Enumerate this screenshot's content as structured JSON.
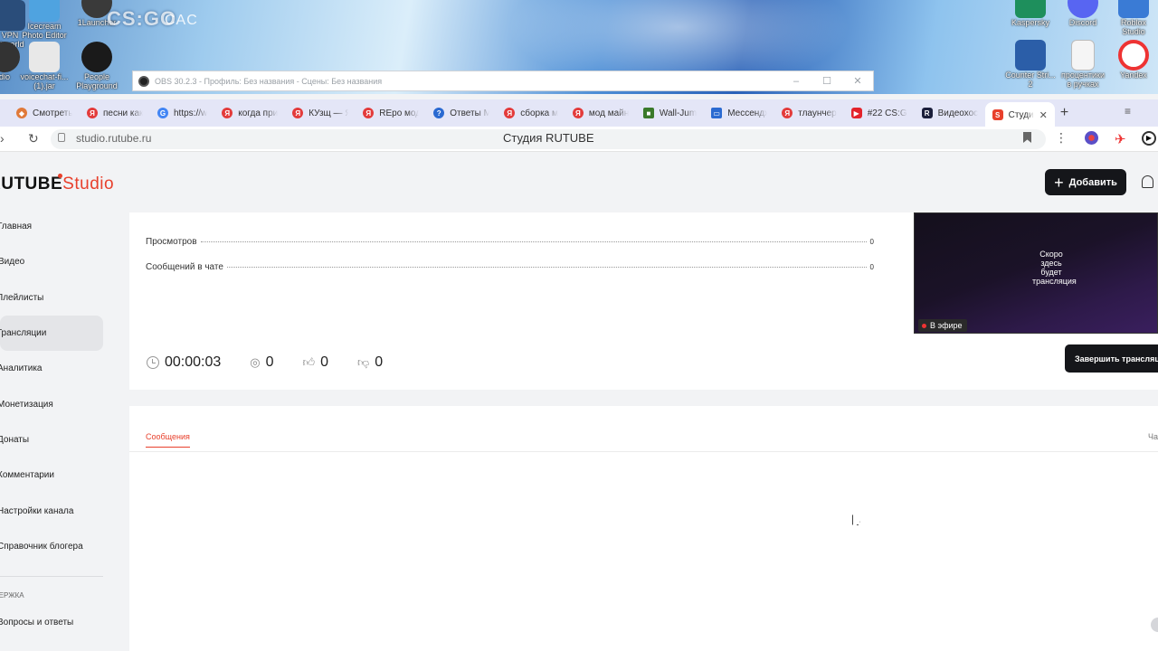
{
  "desktop": {
    "icons": [
      {
        "label": "VPN\nct world",
        "color": "#2a4d7a"
      },
      {
        "label": "Icecream\nPhoto Editor",
        "color": "#4fa3e0"
      },
      {
        "label": "1Launcher",
        "color": "#3a3a3a"
      },
      {
        "label": "dio",
        "color": "#333333"
      },
      {
        "label": "voicechat-fi...\n(1).jar",
        "color": "#e8e8e8"
      },
      {
        "label": "People\nPlayground",
        "color": "#1a1a1a"
      },
      {
        "label": "Kaspersky",
        "color": "#1e8f5c"
      },
      {
        "label": "Discord",
        "color": "#5865f2"
      },
      {
        "label": "Roblox\nStudio",
        "color": "#3a7bd5"
      },
      {
        "label": "Counter Stri...\n2",
        "color": "#2b5ea8"
      },
      {
        "label": "процентики\nв ручках",
        "color": "#f5f5f5"
      },
      {
        "label": "Yandex",
        "color": "#ffffff"
      }
    ],
    "csgo_logo": "CS:GO",
    "cac_logo": "CAC"
  },
  "obs": {
    "title": "OBS 30.2.3 - Профиль: Без названия - Сцены: Без названия",
    "minimize": "–",
    "maximize": "☐",
    "close": "✕"
  },
  "browser": {
    "tabs": [
      {
        "label": "Смотреть",
        "fav_color": "#e07a3a",
        "fav_glyph": "◆"
      },
      {
        "label": "песни как",
        "fav_color": "#e33b3b",
        "fav_glyph": "Я"
      },
      {
        "label": "https://w",
        "fav_color": "#4285f4",
        "fav_glyph": "G"
      },
      {
        "label": "когда при",
        "fav_color": "#e33b3b",
        "fav_glyph": "Я"
      },
      {
        "label": "КУзщ — Я",
        "fav_color": "#e33b3b",
        "fav_glyph": "Я"
      },
      {
        "label": "REpo мод",
        "fav_color": "#e33b3b",
        "fav_glyph": "Я"
      },
      {
        "label": "Ответы М",
        "fav_color": "#2a6ad1",
        "fav_glyph": "?"
      },
      {
        "label": "сборка м",
        "fav_color": "#e33b3b",
        "fav_glyph": "Я"
      },
      {
        "label": "мод майн",
        "fav_color": "#e33b3b",
        "fav_glyph": "Я"
      },
      {
        "label": "Wall-Jum",
        "fav_color": "#3a7a2a",
        "fav_glyph": "■"
      },
      {
        "label": "Мессендж",
        "fav_color": "#2a6ad1",
        "fav_glyph": "▭"
      },
      {
        "label": "тлаунчер",
        "fav_color": "#e33b3b",
        "fav_glyph": "Я"
      },
      {
        "label": "#22 CS:G",
        "fav_color": "#e3232b",
        "fav_glyph": "▶"
      },
      {
        "label": "Видеохост",
        "fav_color": "#1b1f3b",
        "fav_glyph": "R"
      },
      {
        "label": "Студи",
        "fav_color": "#e8402c",
        "fav_glyph": "S"
      }
    ],
    "new_tab": "+",
    "tab_close": "✕",
    "list_tabs_glyph": "≡",
    "url": "studio.rutube.ru",
    "page_title": "Студия RUTUBE"
  },
  "page": {
    "logo_main": "RUTUBE",
    "logo_studio": "Studio",
    "add_button": "Добавить",
    "add_plus": "+",
    "sidebar": {
      "items": [
        {
          "label": "Главная",
          "active": false
        },
        {
          "label": "Видео",
          "active": false
        },
        {
          "label": "Плейлисты",
          "active": false
        },
        {
          "label": "Трансляции",
          "active": true
        },
        {
          "label": "Аналитика",
          "active": false
        },
        {
          "label": "Монетизация",
          "active": false
        },
        {
          "label": "Донаты",
          "active": false
        },
        {
          "label": "Комментарии",
          "active": false
        },
        {
          "label": "Настройки канала",
          "active": false
        },
        {
          "label": "Справочник блогера",
          "active": false
        }
      ],
      "support_section": "ПОДДЕРЖКА",
      "faq": "Вопросы и ответы"
    },
    "stats": [
      {
        "label": "Просмотров",
        "value": "0"
      },
      {
        "label": "Сообщений в чате",
        "value": "0"
      }
    ],
    "preview": {
      "text": "Скоро здесь будет трансляция",
      "live_badge": "В эфире"
    },
    "metrics": {
      "timer": "00:00:03",
      "viewers": "0",
      "likes": "0",
      "dislikes": "0"
    },
    "end_button": "Завершить трансляцию",
    "chat_tabs": {
      "messages": "Сообщения",
      "chat": "Чат"
    }
  }
}
